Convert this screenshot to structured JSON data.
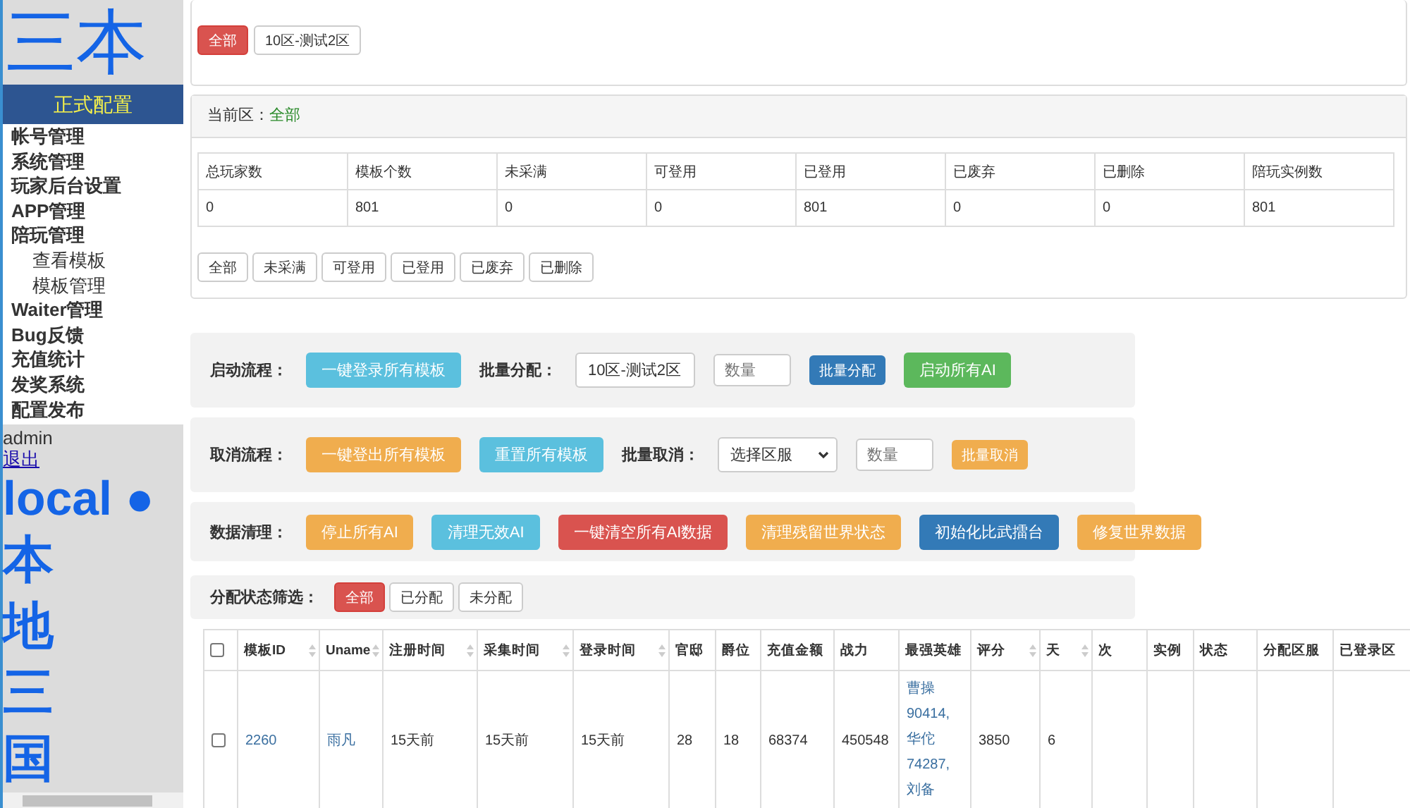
{
  "sidebar": {
    "logo": "三本",
    "section_title": "正式配置",
    "menu": [
      {
        "label": "帐号管理"
      },
      {
        "label": "系统管理"
      },
      {
        "label": "玩家后台设置"
      },
      {
        "label": "APP管理"
      },
      {
        "label": "陪玩管理",
        "children": [
          {
            "label": "查看模板"
          },
          {
            "label": "模板管理"
          }
        ]
      },
      {
        "label": "Waiter管理"
      },
      {
        "label": "Bug反馈"
      },
      {
        "label": "充值统计"
      },
      {
        "label": "发奖系统"
      },
      {
        "label": "配置发布"
      }
    ],
    "user": "admin",
    "logout": "退出",
    "env": "local ●",
    "env_name": "本地三国"
  },
  "zone_filter": [
    {
      "label": "全部",
      "selected": true
    },
    {
      "label": "10区-测试2区",
      "selected": false
    }
  ],
  "summary": {
    "current_label": "当前区：",
    "current_value": "全部",
    "columns": [
      "总玩家数",
      "模板个数",
      "未采满",
      "可登用",
      "已登用",
      "已废弃",
      "已删除",
      "陪玩实例数"
    ],
    "values": [
      "0",
      "801",
      "0",
      "0",
      "801",
      "0",
      "0",
      "801"
    ],
    "filters": [
      "全部",
      "未采满",
      "可登用",
      "已登用",
      "已废弃",
      "已删除"
    ]
  },
  "actions": [
    {
      "label": "启动流程：",
      "items": [
        {
          "kind": "info",
          "text": "一键登录所有模板"
        },
        {
          "kind": "label",
          "text": "批量分配："
        },
        {
          "kind": "select",
          "text": "10区-测试2区"
        },
        {
          "kind": "input",
          "placeholder": "数量"
        },
        {
          "kind": "primary",
          "text": "批量分配",
          "small": true
        },
        {
          "kind": "success",
          "text": "启动所有AI"
        }
      ]
    },
    {
      "label": "取消流程：",
      "items": [
        {
          "kind": "warning",
          "text": "一键登出所有模板"
        },
        {
          "kind": "info",
          "text": "重置所有模板"
        },
        {
          "kind": "label",
          "text": "批量取消："
        },
        {
          "kind": "select",
          "text": "选择区服"
        },
        {
          "kind": "input",
          "placeholder": "数量"
        },
        {
          "kind": "warning",
          "text": "批量取消",
          "small": true
        }
      ]
    },
    {
      "label": "数据清理：",
      "items": [
        {
          "kind": "warning",
          "text": "停止所有AI"
        },
        {
          "kind": "info",
          "text": "清理无效AI"
        },
        {
          "kind": "danger",
          "text": "一键清空所有AI数据"
        },
        {
          "kind": "warning",
          "text": "清理残留世界状态"
        },
        {
          "kind": "primary",
          "text": "初始化比武擂台"
        },
        {
          "kind": "warning",
          "text": "修复世界数据"
        }
      ]
    }
  ],
  "assign_filter": {
    "label": "分配状态筛选：",
    "options": [
      {
        "label": "全部",
        "selected": true
      },
      {
        "label": "已分配",
        "selected": false
      },
      {
        "label": "未分配",
        "selected": false
      }
    ]
  },
  "table": {
    "all_checked": false,
    "columns": [
      {
        "label": "模板ID",
        "sortable": true
      },
      {
        "label": "Uname",
        "sortable": true
      },
      {
        "label": "注册时间",
        "sortable": true
      },
      {
        "label": "采集时间",
        "sortable": true
      },
      {
        "label": "登录时间",
        "sortable": true
      },
      {
        "label": "官邸",
        "sortable": false
      },
      {
        "label": "爵位",
        "sortable": false
      },
      {
        "label": "充值金额",
        "sortable": false
      },
      {
        "label": "战力",
        "sortable": false
      },
      {
        "label": "最强英雄",
        "sortable": false
      },
      {
        "label": "评分",
        "sortable": true
      },
      {
        "label": "天",
        "sortable": true
      },
      {
        "label": "次",
        "sortable": false
      },
      {
        "label": "实例",
        "sortable": false
      },
      {
        "label": "状态",
        "sortable": false
      },
      {
        "label": "分配区服",
        "sortable": false
      },
      {
        "label": "已登录区",
        "sortable": false
      }
    ],
    "rows": [
      {
        "checked": false,
        "cells": [
          "2260",
          "雨凡",
          "15天前",
          "15天前",
          "15天前",
          "28",
          "18",
          "68374",
          "450548",
          "曹操\n90414,\n华佗\n74287,\n刘备",
          "3850",
          "6",
          "",
          "",
          "",
          "",
          ""
        ]
      }
    ]
  }
}
